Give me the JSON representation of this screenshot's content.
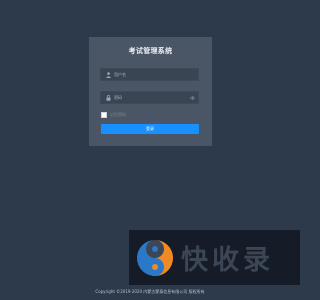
{
  "login": {
    "title": "考试管理系统",
    "username_placeholder": "用户名",
    "password_placeholder": "密码",
    "remember_label": "记住密码",
    "submit_label": "登录"
  },
  "watermark": {
    "text": "快收录"
  },
  "footer": {
    "copyright": "Copyright ©2019-2020 内蒙古蒙泰信息有限公司 版权所有"
  },
  "icons": {
    "username": "user-icon",
    "password": "lock-icon",
    "reveal": "eye-icon",
    "watermark_logo": "yin-yang-logo"
  },
  "colors": {
    "background": "#2d3a4b",
    "card": "#4a5565",
    "accent": "#1890ff"
  }
}
